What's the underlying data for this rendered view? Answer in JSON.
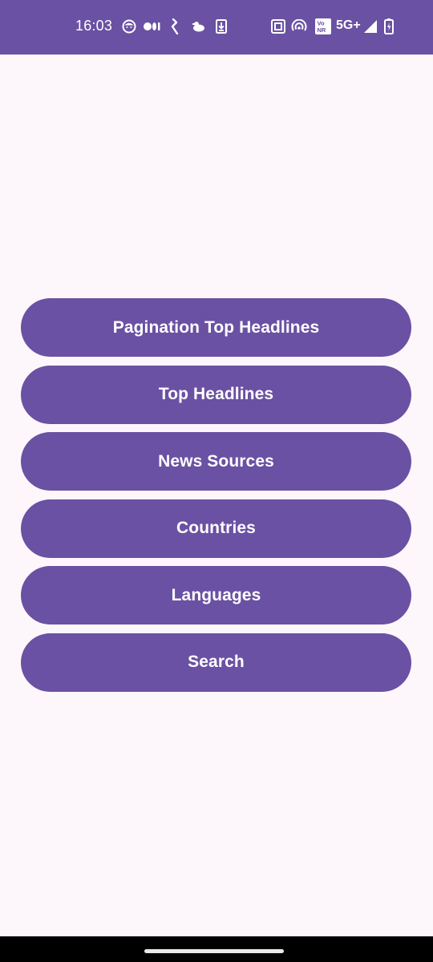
{
  "status_bar": {
    "time": "16:03",
    "network": "5G+",
    "icons": [
      "face-icon",
      "video-icon",
      "notification-k-icon",
      "bird-icon",
      "download-icon",
      "nfc-icon",
      "hotspot-icon",
      "vonr-icon",
      "network-5g-icon",
      "signal-icon",
      "battery-icon"
    ],
    "vonr_label_top": "Vo",
    "vonr_label_bottom": "NR"
  },
  "menu": {
    "buttons": [
      {
        "label": "Pagination Top Headlines"
      },
      {
        "label": "Top Headlines"
      },
      {
        "label": "News Sources"
      },
      {
        "label": "Countries"
      },
      {
        "label": "Languages"
      },
      {
        "label": "Search"
      }
    ]
  },
  "colors": {
    "primary": "#6a51a3",
    "background": "#fdf7fc",
    "on_primary": "#ffffff",
    "nav_bar": "#000000"
  }
}
